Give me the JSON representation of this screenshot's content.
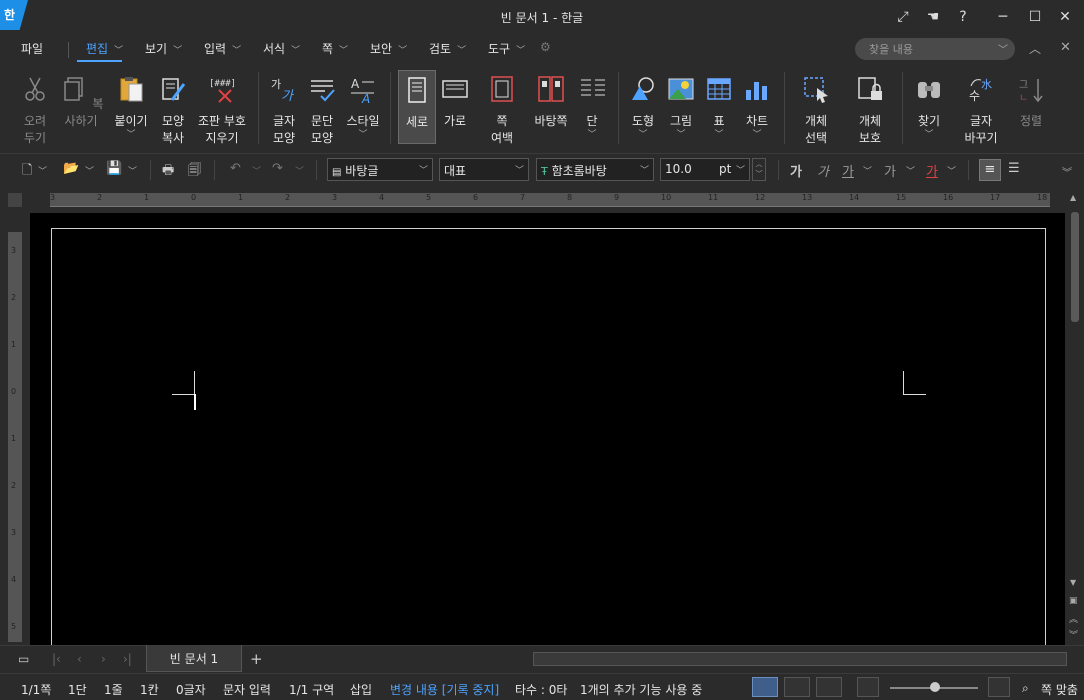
{
  "window": {
    "title": "빈 문서 1 - 한글",
    "logo": "한"
  },
  "menu": {
    "items": [
      {
        "label": "파일"
      },
      {
        "label": "편집"
      },
      {
        "label": "보기"
      },
      {
        "label": "입력"
      },
      {
        "label": "서식"
      },
      {
        "label": "쪽"
      },
      {
        "label": "보안"
      },
      {
        "label": "검토"
      },
      {
        "label": "도구"
      }
    ],
    "search_placeholder": "찾을 내용"
  },
  "ribbon": {
    "cut": "오려\n두기",
    "copy": "복사하기",
    "paste": "붙이기",
    "format_copy": "모양\n복사",
    "clear_marks": "조판 부호\n지우기",
    "char_shape": "글자\n모양",
    "para_shape": "문단\n모양",
    "style": "스타일",
    "vertical": "세로",
    "horizontal": "가로",
    "page_margin": "쪽\n여백",
    "master_page": "바탕쪽",
    "columns": "단",
    "shape": "도형",
    "picture": "그림",
    "table": "표",
    "chart": "차트",
    "select_object": "개체\n선택",
    "protect_object": "개체\n보호",
    "find": "찾기",
    "replace": "글자\n바꾸기",
    "sort": "정렬"
  },
  "toolbar": {
    "style_value": "바탕글",
    "outline_value": "대표",
    "font_value": "함초롬바탕",
    "size_value": "10.0",
    "size_unit": "pt"
  },
  "ruler": {
    "top_ticks": [
      "3",
      "2",
      "1",
      "0",
      "1",
      "2",
      "3",
      "4",
      "5",
      "6",
      "7",
      "8",
      "9",
      "10",
      "11",
      "12",
      "13",
      "14",
      "15",
      "16",
      "17",
      "18"
    ],
    "left_ticks": [
      "3",
      "2",
      "1",
      "0",
      "1",
      "2",
      "3",
      "4",
      "5"
    ]
  },
  "tabs": {
    "doc_tab": "빈 문서 1"
  },
  "status": {
    "page": "1/1쪽",
    "column": "1단",
    "line": "1줄",
    "cell": "1칸",
    "chars": "0글자",
    "input_mode": "문자 입력",
    "section": "1/1 구역",
    "insert": "삽입",
    "track_changes": "변경 내용 [기록 중지]",
    "keystrokes": "타수 : 0타",
    "addons": "1개의 추가 기능 사용 중",
    "zoom_fit": "쪽 맞춤"
  },
  "colors": {
    "accent": "#4da3ff",
    "logo_bg": "#1d8fe6",
    "background": "#2b2b2b",
    "page": "#000000"
  }
}
